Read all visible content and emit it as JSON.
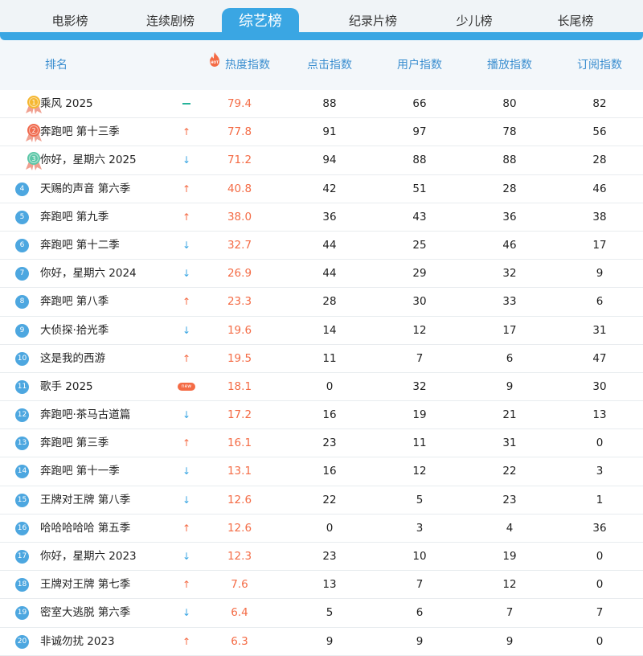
{
  "tabs": [
    {
      "label": "电影榜",
      "active": false
    },
    {
      "label": "连续剧榜",
      "active": false
    },
    {
      "label": "综艺榜",
      "active": true
    },
    {
      "label": "纪录片榜",
      "active": false
    },
    {
      "label": "少儿榜",
      "active": false
    },
    {
      "label": "长尾榜",
      "active": false
    }
  ],
  "header": {
    "rank": "排名",
    "heat": "热度指数",
    "hot_badge": "HOT",
    "click": "点击指数",
    "user": "用户指数",
    "play": "播放指数",
    "subscribe": "订阅指数"
  },
  "colors": {
    "accent": "#3aa6e3",
    "heat": "#f46b45",
    "up": "#f46b45",
    "down": "#3aa6e3",
    "flat": "#26b39a",
    "gold": "#f5b731",
    "silver_red": "#f06b4f",
    "bronze_teal": "#5dc7a8"
  },
  "rows": [
    {
      "rank": "1",
      "name": "乘风 2025",
      "trend": "flat",
      "heat": "79.4",
      "click": "88",
      "user": "66",
      "play": "80",
      "subscribe": "82"
    },
    {
      "rank": "2",
      "name": "奔跑吧 第十三季",
      "trend": "up",
      "heat": "77.8",
      "click": "91",
      "user": "97",
      "play": "78",
      "subscribe": "56"
    },
    {
      "rank": "3",
      "name": "你好，星期六 2025",
      "trend": "down",
      "heat": "71.2",
      "click": "94",
      "user": "88",
      "play": "88",
      "subscribe": "28"
    },
    {
      "rank": "4",
      "name": "天赐的声音 第六季",
      "trend": "up",
      "heat": "40.8",
      "click": "42",
      "user": "51",
      "play": "28",
      "subscribe": "46"
    },
    {
      "rank": "5",
      "name": "奔跑吧 第九季",
      "trend": "up",
      "heat": "38.0",
      "click": "36",
      "user": "43",
      "play": "36",
      "subscribe": "38"
    },
    {
      "rank": "6",
      "name": "奔跑吧 第十二季",
      "trend": "down",
      "heat": "32.7",
      "click": "44",
      "user": "25",
      "play": "46",
      "subscribe": "17"
    },
    {
      "rank": "7",
      "name": "你好，星期六 2024",
      "trend": "down",
      "heat": "26.9",
      "click": "44",
      "user": "29",
      "play": "32",
      "subscribe": "9"
    },
    {
      "rank": "8",
      "name": "奔跑吧 第八季",
      "trend": "up",
      "heat": "23.3",
      "click": "28",
      "user": "30",
      "play": "33",
      "subscribe": "6"
    },
    {
      "rank": "9",
      "name": "大侦探·拾光季",
      "trend": "down",
      "heat": "19.6",
      "click": "14",
      "user": "12",
      "play": "17",
      "subscribe": "31"
    },
    {
      "rank": "10",
      "name": "这是我的西游",
      "trend": "up",
      "heat": "19.5",
      "click": "11",
      "user": "7",
      "play": "6",
      "subscribe": "47"
    },
    {
      "rank": "11",
      "name": "歌手 2025",
      "trend": "new",
      "heat": "18.1",
      "click": "0",
      "user": "32",
      "play": "9",
      "subscribe": "30"
    },
    {
      "rank": "12",
      "name": "奔跑吧·茶马古道篇",
      "trend": "down",
      "heat": "17.2",
      "click": "16",
      "user": "19",
      "play": "21",
      "subscribe": "13"
    },
    {
      "rank": "13",
      "name": "奔跑吧 第三季",
      "trend": "up",
      "heat": "16.1",
      "click": "23",
      "user": "11",
      "play": "31",
      "subscribe": "0"
    },
    {
      "rank": "14",
      "name": "奔跑吧 第十一季",
      "trend": "down",
      "heat": "13.1",
      "click": "16",
      "user": "12",
      "play": "22",
      "subscribe": "3"
    },
    {
      "rank": "15",
      "name": "王牌对王牌 第八季",
      "trend": "down",
      "heat": "12.6",
      "click": "22",
      "user": "5",
      "play": "23",
      "subscribe": "1"
    },
    {
      "rank": "16",
      "name": "哈哈哈哈哈 第五季",
      "trend": "up",
      "heat": "12.6",
      "click": "0",
      "user": "3",
      "play": "4",
      "subscribe": "36"
    },
    {
      "rank": "17",
      "name": "你好，星期六 2023",
      "trend": "down",
      "heat": "12.3",
      "click": "23",
      "user": "10",
      "play": "19",
      "subscribe": "0"
    },
    {
      "rank": "18",
      "name": "王牌对王牌 第七季",
      "trend": "up",
      "heat": "7.6",
      "click": "13",
      "user": "7",
      "play": "12",
      "subscribe": "0"
    },
    {
      "rank": "19",
      "name": "密室大逃脱 第六季",
      "trend": "down",
      "heat": "6.4",
      "click": "5",
      "user": "6",
      "play": "7",
      "subscribe": "7"
    },
    {
      "rank": "20",
      "name": "非诚勿扰 2023",
      "trend": "up",
      "heat": "6.3",
      "click": "9",
      "user": "9",
      "play": "9",
      "subscribe": "0"
    }
  ],
  "trend_symbols": {
    "up": "↑",
    "down": "↓",
    "flat": "—",
    "new": "new"
  }
}
